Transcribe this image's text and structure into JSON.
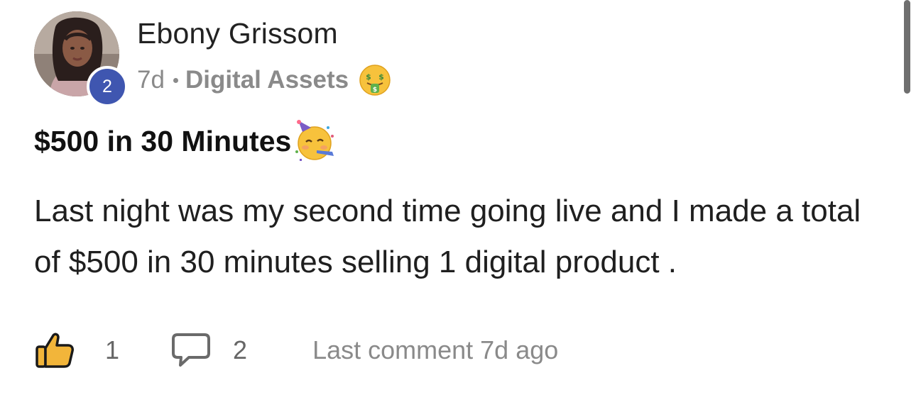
{
  "post": {
    "author": {
      "name": "Ebony Grissom",
      "level": "2"
    },
    "meta": {
      "time_ago": "7d",
      "category": "Digital Assets",
      "category_emoji": "money-mouth-face-icon"
    },
    "title": "$500 in 30 Minutes",
    "title_emoji": "partying-face-icon",
    "body": "Last night was my second time going live and I made a total of $500 in 30 minutes selling 1 digital product .",
    "actions": {
      "like_count": "1",
      "comment_count": "2",
      "last_comment": "Last comment 7d ago"
    }
  },
  "colors": {
    "level_badge": "#3f56b0",
    "like_icon": "#f2b53a",
    "muted_text": "#8a8a8a"
  }
}
